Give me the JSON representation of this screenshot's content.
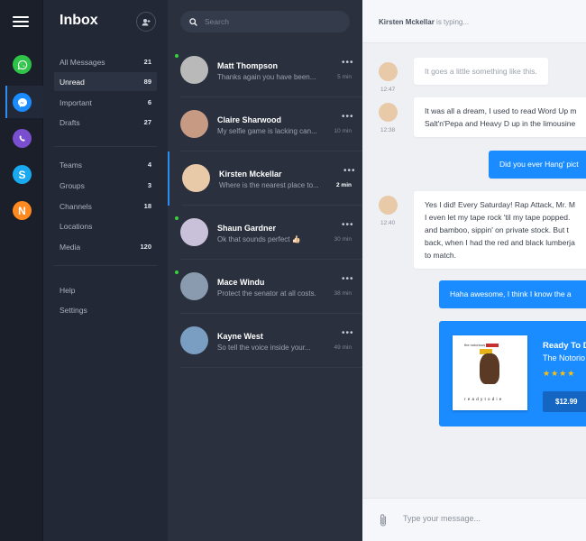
{
  "rail": {
    "apps": [
      {
        "name": "whatsapp",
        "color": "#2fc34a"
      },
      {
        "name": "messenger",
        "color": "#1a8cff"
      },
      {
        "name": "viber",
        "color": "#7a4fcf"
      },
      {
        "name": "skype",
        "color": "#19a9f0"
      },
      {
        "name": "other",
        "color": "#ff8a1f",
        "letter": "N"
      }
    ],
    "active_app": "messenger"
  },
  "nav": {
    "title": "Inbox",
    "primary": [
      {
        "label": "All Messages",
        "count": "21"
      },
      {
        "label": "Unread",
        "count": "89",
        "active": true
      },
      {
        "label": "Important",
        "count": "6"
      },
      {
        "label": "Drafts",
        "count": "27"
      }
    ],
    "secondary": [
      {
        "label": "Teams",
        "count": "4"
      },
      {
        "label": "Groups",
        "count": "3"
      },
      {
        "label": "Channels",
        "count": "18"
      },
      {
        "label": "Locations",
        "count": ""
      },
      {
        "label": "Media",
        "count": "120"
      }
    ],
    "tertiary": [
      {
        "label": "Help"
      },
      {
        "label": "Settings"
      }
    ]
  },
  "search": {
    "placeholder": "Search"
  },
  "conversations": [
    {
      "name": "Matt Thompson",
      "message": "Thanks again you have been...",
      "time": "5 min",
      "online": true,
      "avatar_color": "#b9b9b9"
    },
    {
      "name": "Claire Sharwood",
      "message": "My selfie game is lacking can...",
      "time": "10 min",
      "online": false,
      "avatar_color": "#c79a84"
    },
    {
      "name": "Kirsten Mckellar",
      "message": "Where is the nearest place to...",
      "time": "2 min",
      "online": false,
      "selected": true,
      "avatar_color": "#e8c9a8"
    },
    {
      "name": "Shaun Gardner",
      "message": "Ok that sounds perfect 👍🏻",
      "time": "30 min",
      "online": true,
      "avatar_color": "#c9c0d9"
    },
    {
      "name": "Mace Windu",
      "message": "Protect the senator at all costs.",
      "time": "38 min",
      "online": true,
      "avatar_color": "#8a9bb0"
    },
    {
      "name": "Kayne West",
      "message": "So tell the voice inside your...",
      "time": "49 min",
      "online": false,
      "avatar_color": "#7a9ec2"
    }
  ],
  "chat": {
    "typing_name": "Kirsten Mckellar",
    "typing_suffix": " is typing...",
    "messages": [
      {
        "text": "It goes a little something like this.",
        "time": "12:47"
      },
      {
        "text": "It was all a dream, I used to read Word Up m\nSalt'n'Pepa and Heavy D up in the limousine",
        "time": "12:38"
      },
      {
        "text": "Did you ever Hang' pict"
      },
      {
        "text": "Yes I did! Every Saturday! Rap Attack, Mr. M\nI even let my tape rock 'til my tape popped.\nand bamboo, sippin' on private stock. But t\nback, when I had the red and black lumberja\nto match.",
        "time": "12:40"
      },
      {
        "text": "Haha awesome,  I think I know the a"
      }
    ],
    "card": {
      "title": "Ready To D",
      "subtitle": "The Notorio",
      "stars": "★★★★",
      "price": "$12.99",
      "album_band": "the notorious",
      "album_title": "r e a d y t o d i e"
    },
    "composer_placeholder": "Type your message..."
  }
}
